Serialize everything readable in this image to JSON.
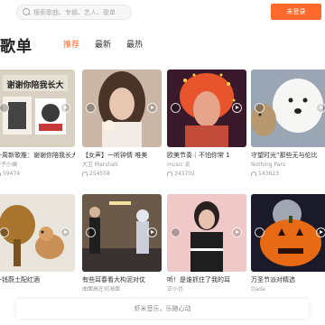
{
  "search": {
    "placeholder": "搜索歌曲、专辑、艺人、歌单"
  },
  "header": {
    "login_label": "未登录"
  },
  "section": {
    "title": "歌单",
    "tabs": [
      {
        "label": "推荐",
        "active": true
      },
      {
        "label": "最新",
        "active": false
      },
      {
        "label": "最热",
        "active": false
      }
    ]
  },
  "playlists": [
    {
      "title": "一周新歌推：谢谢你陪我长大",
      "author": "虾子小编",
      "plays": "59474",
      "cover_text": "谢谢你陪我长大"
    },
    {
      "title": "【女声】一听钟情 唯美",
      "author": "大卫 Marshall",
      "plays": "254558"
    },
    {
      "title": "欧美节奏｜不怕你常 1",
      "author": "music 说",
      "plays": "343702"
    },
    {
      "title": "守望时光”那些无与伦比",
      "author": "Nothing Pars",
      "plays": "143623"
    },
    {
      "title": "一钱蔚土配红酒",
      "author": "",
      "plays": ""
    },
    {
      "title": "有些耳春看大构泥对仗",
      "author": "曲面高在何海面",
      "plays": ""
    },
    {
      "title": "听！是谁抓住了我的耳",
      "author": "正小也",
      "plays": ""
    },
    {
      "title": "万圣节派对精选",
      "author": "Dada",
      "plays": ""
    }
  ],
  "footer": {
    "text": "虾米音乐，乐随心动"
  },
  "colors": {
    "accent": "#ff6a2c"
  },
  "icons": [
    "search-icon",
    "headphone-icon",
    "heart-icon",
    "play-icon"
  ]
}
